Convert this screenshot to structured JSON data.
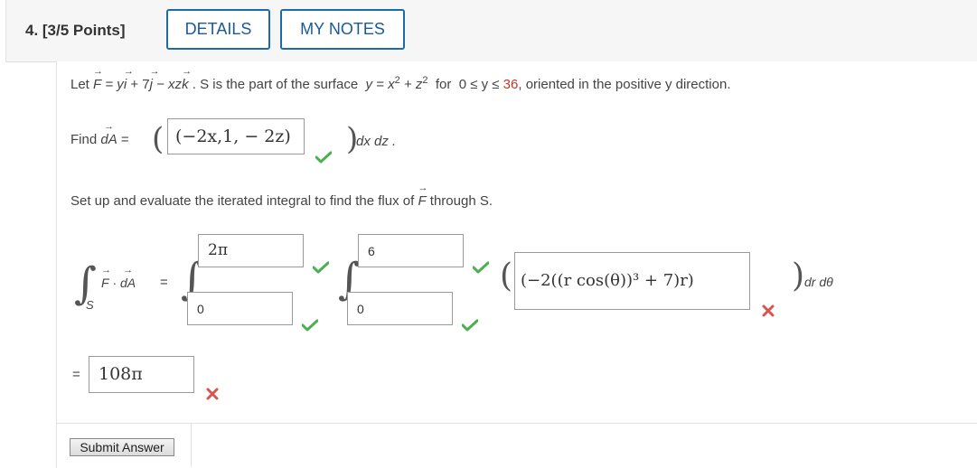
{
  "header": {
    "question_label": "4. [3/5 Points]",
    "details_label": "DETAILS",
    "mynotes_label": "MY NOTES"
  },
  "problem": {
    "let_text": "Let",
    "field_F": "F",
    "eq_y": "= y",
    "i": "i",
    "plus7": "+ 7",
    "j": "j",
    "minus_xz": "− xz",
    "k": "k",
    "surface_text": ". S is the part of the surface",
    "surface_eq": "y = x",
    "sup2a": "2",
    "plus_z": "+ z",
    "sup2b": "2",
    "for_text": "for",
    "range_text": "0 ≤ y ≤",
    "range_max": "36",
    "oriented_text": ", oriented in the positive y direction.",
    "find_label": "Find",
    "dA": "dA",
    "equals": "=",
    "dA_answer": "(−2x,1, − 2z)",
    "dx_dz": "dx dz .",
    "setup_text": "Set up and evaluate the iterated integral to find the flux of",
    "setup_F": "F",
    "through_S": "through S.",
    "integrand_F": "F",
    "dot": "·",
    "integrand_dA": "dA",
    "int_equals": "=",
    "sub_S": "S",
    "outer_upper": "2π",
    "outer_lower": "0",
    "inner_upper": "6",
    "inner_lower": "0",
    "integrand_answer": "(−2((r cos(θ))³ + 7)r)",
    "dr_dtheta": "dr dθ",
    "result_equals": "=",
    "result_answer": "108π"
  },
  "footer": {
    "submit_label": "Submit Answer"
  },
  "colors": {
    "accent": "#1b6baa",
    "correct": "#4caf50",
    "incorrect": "#d9534f",
    "highlight_value": "#c0392b"
  },
  "icons": {
    "correct": "check-icon",
    "incorrect": "x-icon"
  }
}
